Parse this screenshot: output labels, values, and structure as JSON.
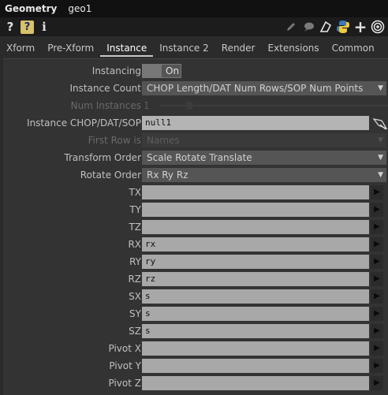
{
  "titlebar": {
    "type": "Geometry",
    "name": "geo1"
  },
  "toolbar": {
    "left": [
      "help-icon",
      "python-help-icon",
      "info-icon"
    ],
    "right": [
      "pencil-icon",
      "comment-icon",
      "clone-icon",
      "python-icon",
      "plus-icon",
      "target-icon"
    ]
  },
  "tabs": [
    "Xform",
    "Pre-Xform",
    "Instance",
    "Instance 2",
    "Render",
    "Extensions",
    "Common"
  ],
  "active_tab": "Instance",
  "params": {
    "instancing": {
      "label": "Instancing",
      "value": "On"
    },
    "instance_count": {
      "label": "Instance Count",
      "value": "CHOP Length/DAT Num Rows/SOP Num Points"
    },
    "num_instances": {
      "label": "Num Instances",
      "value": "1"
    },
    "instance_op": {
      "label": "Instance CHOP/DAT/SOP",
      "value": "null1"
    },
    "first_row": {
      "label": "First Row is",
      "value": "Names"
    },
    "transform_order": {
      "label": "Transform Order",
      "value": "Scale Rotate Translate"
    },
    "rotate_order": {
      "label": "Rotate Order",
      "value": "Rx Ry Rz"
    }
  },
  "fields": [
    {
      "label": "TX",
      "value": ""
    },
    {
      "label": "TY",
      "value": ""
    },
    {
      "label": "TZ",
      "value": ""
    },
    {
      "label": "RX",
      "value": "rx"
    },
    {
      "label": "RY",
      "value": "ry"
    },
    {
      "label": "RZ",
      "value": "rz"
    },
    {
      "label": "SX",
      "value": "s"
    },
    {
      "label": "SY",
      "value": "s"
    },
    {
      "label": "SZ",
      "value": "s"
    },
    {
      "label": "Pivot X",
      "value": ""
    },
    {
      "label": "Pivot Y",
      "value": ""
    },
    {
      "label": "Pivot Z",
      "value": ""
    }
  ]
}
